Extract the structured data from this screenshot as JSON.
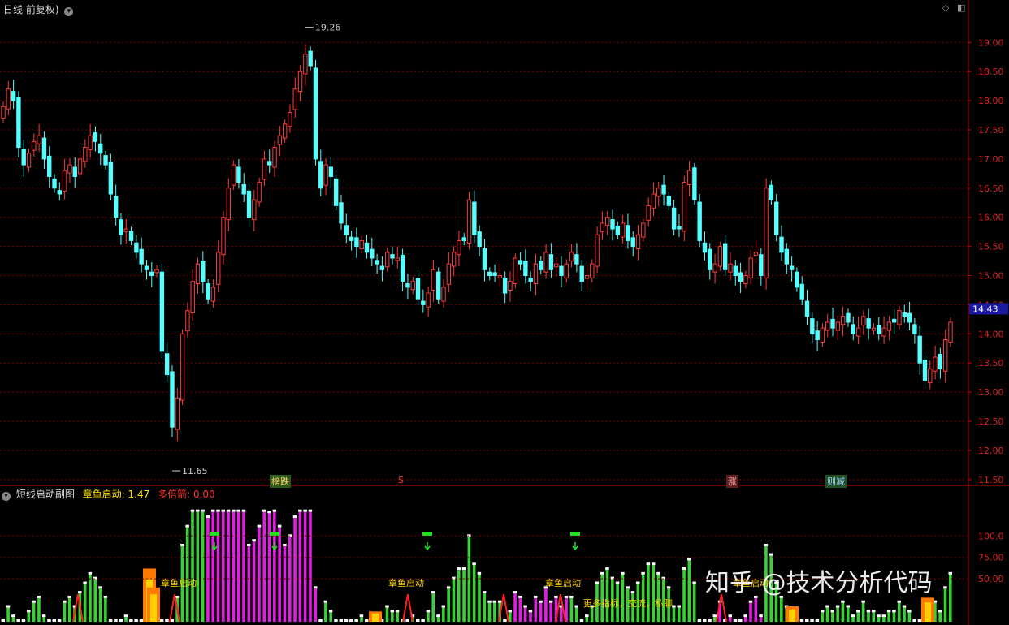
{
  "header": {
    "period_label": "日线 前复权)",
    "dropdown_icon": "chevron-down-icon"
  },
  "indicator_header": {
    "name": "短线启动副图",
    "label1": "章鱼启动:",
    "value1": "1.47",
    "label2": "多倍箭:",
    "value2": "0.00"
  },
  "markers": [
    {
      "text": "榜跌",
      "color": "#d9a53a"
    },
    {
      "text": "S",
      "color": "#ff3030"
    },
    {
      "text": "涨",
      "color": "#ff5050"
    },
    {
      "text": "则减",
      "color": "#44ddff"
    }
  ],
  "signal_labels": [
    "章鱼启动",
    "章鱼启动",
    "章鱼启动",
    "章鱼启动"
  ],
  "overlay_text": "更多指标，交流，私聊",
  "watermark": "知乎 @技术分析代码",
  "colors": {
    "up": "#ff3a3a",
    "down": "#54ffff",
    "grid": "#7a0000",
    "axis": "#c00000",
    "accent_green": "#39d133",
    "accent_magenta": "#e020e0",
    "accent_yellow": "#ffd000"
  },
  "chart_data": {
    "type": "candlestick",
    "price_axis": {
      "ticks": [
        "19.00",
        "18.50",
        "18.00",
        "17.50",
        "17.00",
        "16.50",
        "16.00",
        "15.50",
        "15.00",
        "14.50",
        "14.00",
        "13.50",
        "13.00",
        "12.50",
        "12.00",
        "11.50"
      ],
      "range": [
        11.4,
        19.45
      ],
      "current_price": "14.43"
    },
    "annotations": {
      "high": "19.26",
      "low": "11.65"
    },
    "close": [
      17.9,
      18.2,
      18.0,
      17.2,
      16.9,
      17.1,
      17.3,
      17.4,
      17.0,
      16.7,
      16.5,
      16.4,
      16.8,
      16.9,
      16.7,
      17.0,
      17.2,
      17.4,
      17.3,
      17.1,
      16.9,
      16.4,
      16.0,
      15.7,
      15.8,
      15.6,
      15.4,
      15.2,
      15.1,
      15.0,
      15.1,
      13.7,
      13.3,
      12.4,
      12.9,
      14.0,
      14.4,
      14.9,
      15.2,
      14.9,
      14.6,
      14.8,
      15.4,
      16.0,
      16.5,
      16.9,
      16.6,
      16.4,
      16.0,
      16.3,
      16.6,
      17.0,
      16.9,
      17.2,
      17.4,
      17.6,
      17.8,
      18.2,
      18.5,
      18.8,
      18.6,
      17.0,
      16.5,
      16.9,
      16.7,
      16.2,
      15.9,
      15.7,
      15.6,
      15.5,
      15.6,
      15.4,
      15.3,
      15.2,
      15.1,
      15.4,
      15.3,
      15.3,
      14.9,
      14.8,
      14.9,
      14.6,
      14.5,
      14.7,
      15.1,
      14.6,
      14.8,
      15.2,
      15.4,
      15.6,
      15.6,
      16.3,
      15.7,
      15.5,
      15.1,
      15.0,
      15.0,
      15.0,
      14.7,
      14.9,
      15.3,
      15.2,
      15.0,
      14.9,
      15.2,
      15.1,
      15.4,
      15.1,
      15.2,
      15.0,
      15.2,
      15.4,
      15.2,
      14.9,
      15.0,
      15.2,
      15.7,
      15.9,
      16.0,
      15.8,
      15.7,
      15.9,
      15.6,
      15.5,
      15.7,
      15.9,
      16.2,
      16.4,
      16.5,
      16.4,
      16.2,
      15.8,
      15.8,
      16.6,
      16.8,
      16.3,
      15.6,
      15.4,
      15.1,
      15.2,
      15.5,
      15.1,
      15.2,
      15.0,
      14.9,
      15.0,
      15.3,
      15.4,
      15.0,
      16.5,
      16.3,
      15.7,
      15.4,
      15.2,
      15.1,
      14.8,
      14.6,
      14.3,
      14.0,
      13.9,
      14.1,
      14.2,
      14.1,
      14.2,
      14.3,
      14.2,
      14.0,
      14.1,
      14.3,
      14.1,
      14.1,
      14.0,
      14.1,
      14.2,
      14.2,
      14.4,
      14.3,
      14.2,
      14.0,
      13.5,
      13.2,
      13.4,
      13.6,
      13.4,
      13.9,
      14.2
    ],
    "indicator_axis": {
      "ticks": [
        "100.0",
        "75.00",
        "50.00"
      ]
    }
  }
}
